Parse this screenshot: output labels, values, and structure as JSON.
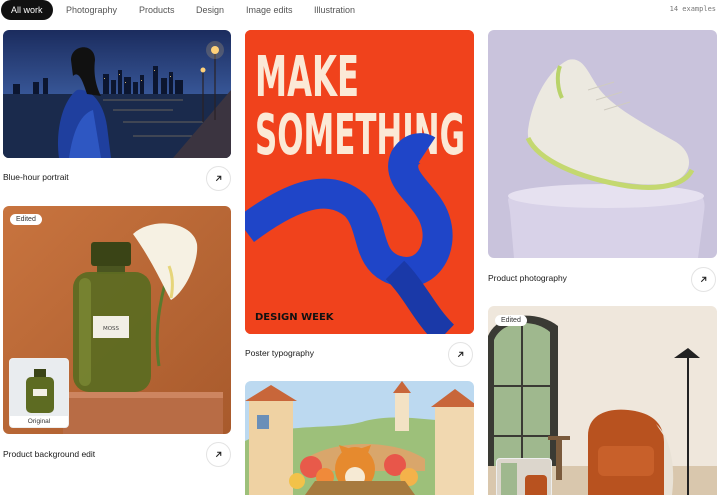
{
  "filters": {
    "items": [
      "All work",
      "Photography",
      "Products",
      "Design",
      "Image edits",
      "Illustration"
    ],
    "count": "14 examples"
  },
  "cards": {
    "portrait": {
      "caption": "Blue-hour portrait"
    },
    "poster": {
      "caption": "Poster typography",
      "headline_1": "MAKE",
      "headline_2": "SOMETHING",
      "footer": "DESIGN WEEK"
    },
    "sneaker": {
      "caption": "Product photography"
    },
    "perfume": {
      "caption": "Product background edit",
      "badge": "Edited",
      "thumb_label": "Original",
      "bottle_label": "MOSS"
    },
    "village": {
      "caption": ""
    },
    "interior": {
      "badge": "Edited"
    }
  },
  "colors": {
    "accent_dark": "#111111",
    "poster_orange": "#f0421c",
    "poster_ribbon": "#1f45c8"
  }
}
